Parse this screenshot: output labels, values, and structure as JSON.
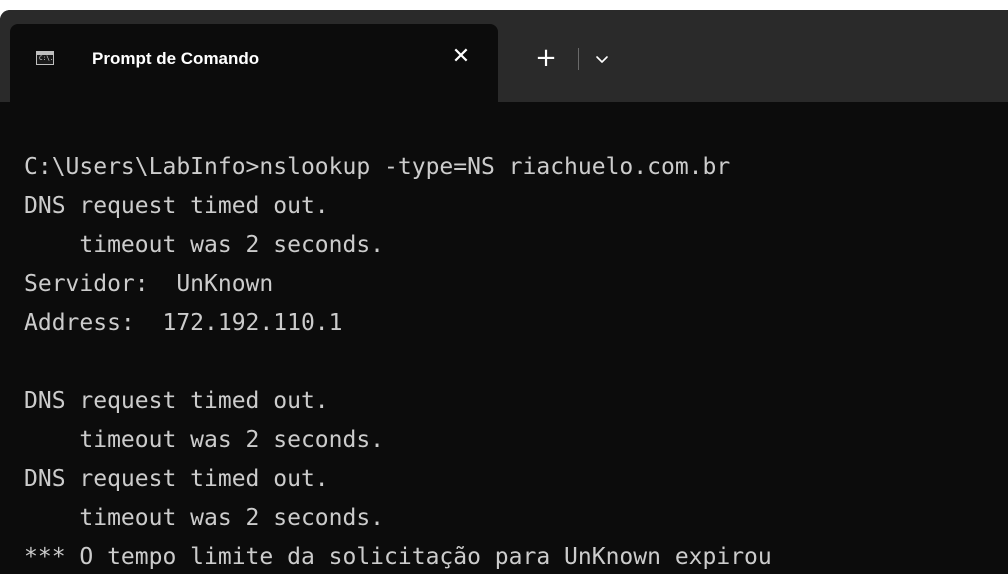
{
  "tab": {
    "title": "Prompt de Comando",
    "icon": "cmd-icon",
    "icon_glyph": "C:\\.",
    "close_symbol": "✕"
  },
  "toolbar": {
    "new_tab_symbol": "+",
    "dropdown_icon": "chevron-down-icon"
  },
  "colors": {
    "titlebar": "#2a2a2a",
    "console_bg": "#0c0c0c",
    "console_text": "#cccccc"
  },
  "console": {
    "lines": [
      "C:\\Users\\LabInfo>nslookup -type=NS riachuelo.com.br",
      "DNS request timed out.",
      "    timeout was 2 seconds.",
      "Servidor:  UnKnown",
      "Address:  172.192.110.1",
      "",
      "DNS request timed out.",
      "    timeout was 2 seconds.",
      "DNS request timed out.",
      "    timeout was 2 seconds.",
      "*** O tempo limite da solicitação para UnKnown expirou"
    ]
  }
}
